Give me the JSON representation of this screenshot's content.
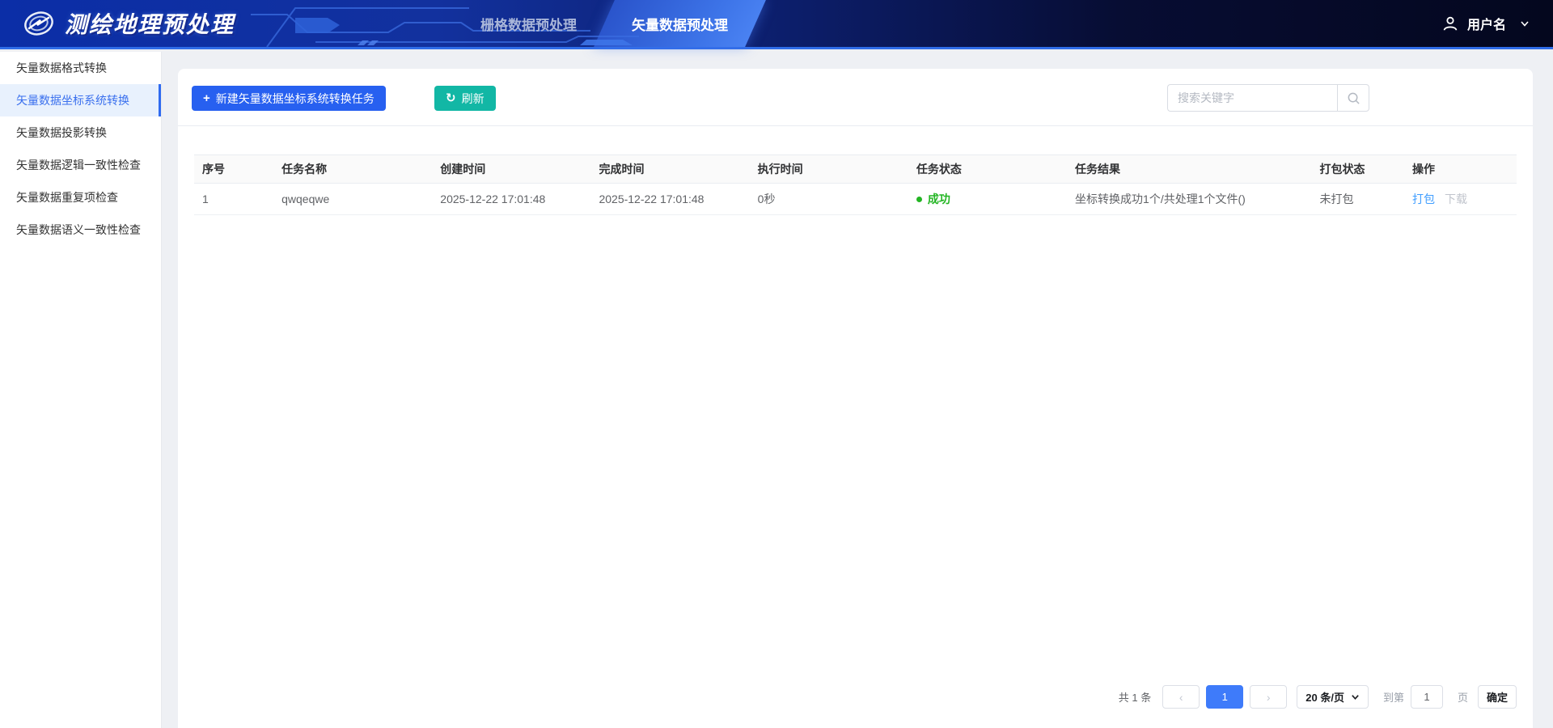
{
  "header": {
    "app_title": "测绘地理预处理",
    "tabs": [
      {
        "label": "栅格数据预处理",
        "active": false
      },
      {
        "label": "矢量数据预处理",
        "active": true
      }
    ],
    "username": "用户名"
  },
  "sidebar": {
    "items": [
      {
        "label": "矢量数据格式转换",
        "active": false
      },
      {
        "label": "矢量数据坐标系统转换",
        "active": true
      },
      {
        "label": "矢量数据投影转换",
        "active": false
      },
      {
        "label": "矢量数据逻辑一致性检查",
        "active": false
      },
      {
        "label": "矢量数据重复项检查",
        "active": false
      },
      {
        "label": "矢量数据语义一致性检查",
        "active": false
      }
    ]
  },
  "toolbar": {
    "create_label": "新建矢量数据坐标系统转换任务",
    "create_icon": "+",
    "refresh_label": "刷新",
    "refresh_icon": "↻",
    "search_placeholder": "搜索关键字"
  },
  "table": {
    "columns": [
      "序号",
      "任务名称",
      "创建时间",
      "完成时间",
      "执行时间",
      "任务状态",
      "任务结果",
      "打包状态",
      "操作"
    ],
    "rows": [
      {
        "index": "1",
        "name": "qwqeqwe",
        "created": "2025-12-22 17:01:48",
        "finished": "2025-12-22 17:01:48",
        "duration": "0秒",
        "status": "成功",
        "result": "坐标转换成功1个/共处理1个文件()",
        "package_status": "未打包",
        "action_pack": "打包",
        "action_download": "下载"
      }
    ]
  },
  "pagination": {
    "total_label": "共 1 条",
    "prev": "‹",
    "current_page": "1",
    "next": "›",
    "page_size_label": "20 条/页",
    "goto_prefix": "到第",
    "goto_value": "1",
    "goto_suffix": "页",
    "confirm_label": "确定"
  },
  "colors": {
    "accent_blue": "#2760f0",
    "teal": "#12b7a5",
    "success_green": "#23b523",
    "link_blue": "#409eff",
    "active_page": "#3e7bfa"
  }
}
